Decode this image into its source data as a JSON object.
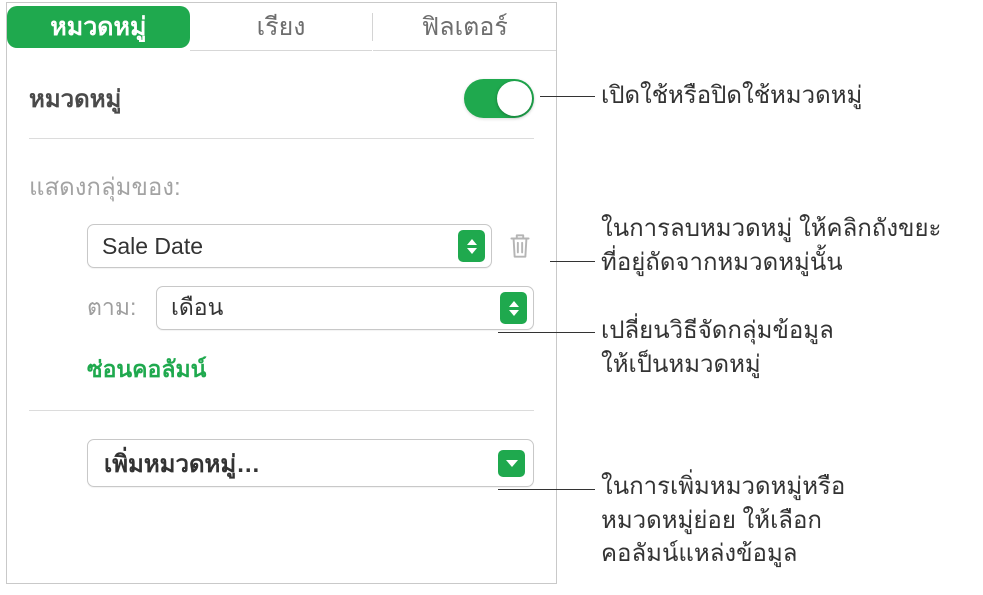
{
  "tabs": {
    "categories": "หมวดหมู่",
    "sort": "เรียง",
    "filter": "ฟิลเตอร์"
  },
  "panel": {
    "toggle_label": "หมวดหมู่",
    "group_of_label": "แสดงกลุ่มของ:",
    "primary_field": "Sale Date",
    "by_label": "ตาม:",
    "by_value": "เดือน",
    "hide_column": "ซ่อนคอลัมน์",
    "add_category": "เพิ่มหมวดหมู่…"
  },
  "annotations": {
    "toggle": "เปิดใช้หรือปิดใช้หมวดหมู่",
    "trash_line1": "ในการลบหมวดหมู่ ให้คลิกถังขยะ",
    "trash_line2": "ที่อยู่ถัดจากหมวดหมู่นั้น",
    "by_line1": "เปลี่ยนวิธีจัดกลุ่มข้อมูล",
    "by_line2": "ให้เป็นหมวดหมู่",
    "add_line1": "ในการเพิ่มหมวดหมู่หรือ",
    "add_line2": "หมวดหมู่ย่อย ให้เลือก",
    "add_line3": "คอลัมน์แหล่งข้อมูล"
  }
}
